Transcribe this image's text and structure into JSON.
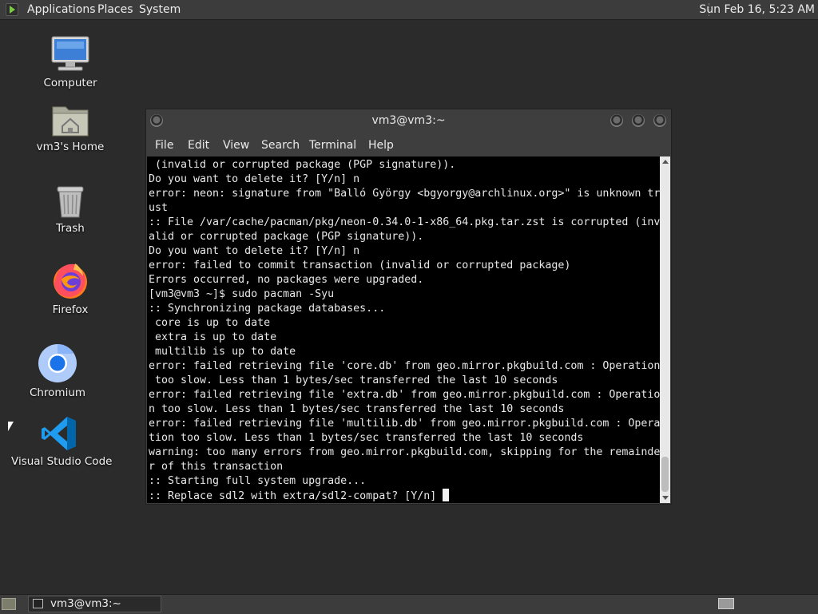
{
  "top_panel": {
    "menus": [
      "Applications",
      "Places",
      "System"
    ],
    "clock": "Sun Feb 16,  5:23 AM"
  },
  "desktop": {
    "icons": [
      {
        "label": "Computer",
        "icon": "computer-icon"
      },
      {
        "label": "vm3's Home",
        "icon": "home-folder-icon"
      },
      {
        "label": "Trash",
        "icon": "trash-icon"
      },
      {
        "label": "Firefox",
        "icon": "firefox-icon"
      },
      {
        "label": "Chromium",
        "icon": "chromium-icon"
      },
      {
        "label": "Visual Studio Code",
        "icon": "vscode-icon"
      }
    ]
  },
  "terminal": {
    "title": "vm3@vm3:~",
    "menu": [
      "File",
      "Edit",
      "View",
      "Search",
      "Terminal",
      "Help"
    ],
    "lines": [
      " (invalid or corrupted package (PGP signature)).",
      "Do you want to delete it? [Y/n] n",
      "error: neon: signature from \"Balló György <bgyorgy@archlinux.org>\" is unknown tr",
      "ust",
      ":: File /var/cache/pacman/pkg/neon-0.34.0-1-x86_64.pkg.tar.zst is corrupted (inv",
      "alid or corrupted package (PGP signature)).",
      "Do you want to delete it? [Y/n] n",
      "error: failed to commit transaction (invalid or corrupted package)",
      "Errors occurred, no packages were upgraded.",
      "[vm3@vm3 ~]$ sudo pacman -Syu",
      ":: Synchronizing package databases...",
      " core is up to date",
      " extra is up to date",
      " multilib is up to date",
      "error: failed retrieving file 'core.db' from geo.mirror.pkgbuild.com : Operation",
      " too slow. Less than 1 bytes/sec transferred the last 10 seconds",
      "error: failed retrieving file 'extra.db' from geo.mirror.pkgbuild.com : Operatio",
      "n too slow. Less than 1 bytes/sec transferred the last 10 seconds",
      "error: failed retrieving file 'multilib.db' from geo.mirror.pkgbuild.com : Opera",
      "tion too slow. Less than 1 bytes/sec transferred the last 10 seconds",
      "warning: too many errors from geo.mirror.pkgbuild.com, skipping for the remainde",
      "r of this transaction",
      ":: Starting full system upgrade...",
      ":: Replace sdl2 with extra/sdl2-compat? [Y/n] "
    ]
  },
  "taskbar": {
    "task_label": "vm3@vm3:~"
  }
}
